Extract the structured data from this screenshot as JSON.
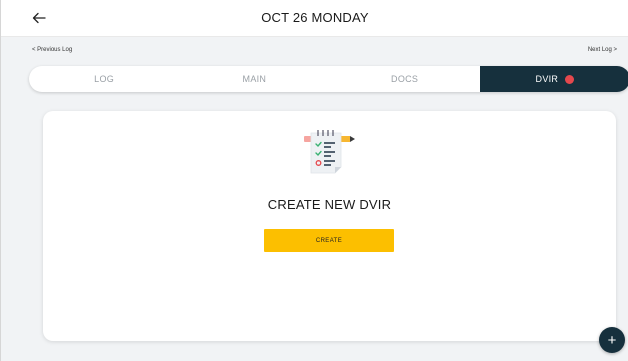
{
  "header": {
    "back_icon": "arrow-left-icon",
    "title": "OCT 26 MONDAY"
  },
  "log_nav": {
    "previous_label": "< Previous Log",
    "next_label": "Next Log >"
  },
  "tabs": [
    {
      "label": "LOG",
      "active": false
    },
    {
      "label": "MAIN",
      "active": false
    },
    {
      "label": "DOCS",
      "active": false
    },
    {
      "label": "DVIR",
      "active": true,
      "badge_color": "#e5484d"
    }
  ],
  "card": {
    "icon": "checklist-document-icon",
    "heading": "CREATE NEW DVIR",
    "create_button_label": "CREATE"
  },
  "fab": {
    "label": "+",
    "icon": "plus-icon"
  },
  "colors": {
    "accent_dark": "#16303d",
    "button_yellow": "#fcbf00",
    "status_red": "#e5484d",
    "background": "#f1f3f5"
  }
}
